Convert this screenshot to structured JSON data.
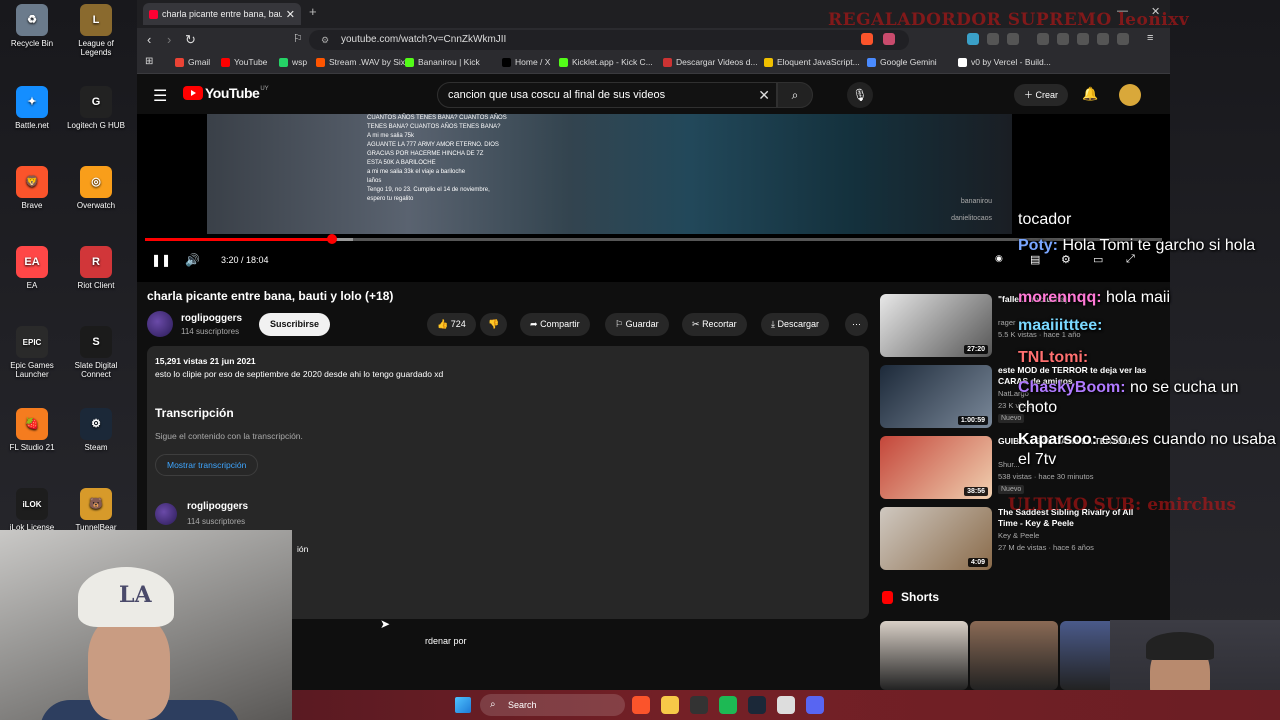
{
  "stream_overlay": {
    "title": "REGALADORDOR SUPREMO leonixv",
    "last_sub": "ULTIMO SUB: emirchus",
    "chat": [
      {
        "user": "",
        "text": "tocador",
        "color": "#ffffff"
      },
      {
        "user": "Poty:",
        "text": " Hola Tomi te garcho si hola",
        "color": "#7aa6ff"
      },
      {
        "user": "morennqq:",
        "text": " hola maii",
        "color": "#ff7ad6"
      },
      {
        "user": "maaiiitttee:",
        "text": "",
        "color": "#7ad8ff"
      },
      {
        "user": "TNLtomi:",
        "text": "",
        "color": "#ff7070"
      },
      {
        "user": "ChaskyBoom:",
        "text": " no se cucha un choto",
        "color": "#b07aff"
      },
      {
        "user": "Kaparsoo:",
        "text": " eso es cuando no usaba el 7tv",
        "color": "#ffffff"
      }
    ]
  },
  "desktop": {
    "icons": [
      {
        "label": "Recycle Bin",
        "icon": "recycle-bin-icon",
        "color": "#6b7b8c",
        "glyph": "♻"
      },
      {
        "label": "League of Legends",
        "icon": "league-icon",
        "color": "#8a6a2e",
        "glyph": "L"
      },
      {
        "label": "Battle.net",
        "icon": "battlenet-icon",
        "color": "#148eff",
        "glyph": "✦"
      },
      {
        "label": "Logitech G HUB",
        "icon": "logitech-icon",
        "color": "#222222",
        "glyph": "G"
      },
      {
        "label": "Brave",
        "icon": "brave-icon",
        "color": "#fb542b",
        "glyph": "🦁"
      },
      {
        "label": "Overwatch",
        "icon": "overwatch-icon",
        "color": "#f99e1a",
        "glyph": "◎"
      },
      {
        "label": "EA",
        "icon": "ea-icon",
        "color": "#ff4747",
        "glyph": "EA"
      },
      {
        "label": "Riot Client",
        "icon": "riot-icon",
        "color": "#d13639",
        "glyph": "R"
      },
      {
        "label": "Epic Games Launcher",
        "icon": "epic-icon",
        "color": "#2a2a2a",
        "glyph": "EPIC"
      },
      {
        "label": "Slate Digital Connect",
        "icon": "slate-icon",
        "color": "#1b1b1b",
        "glyph": "S"
      },
      {
        "label": "FL Studio 21",
        "icon": "flstudio-icon",
        "color": "#f57c1f",
        "glyph": "🍓"
      },
      {
        "label": "Steam",
        "icon": "steam-icon",
        "color": "#1b2838",
        "glyph": "⚙"
      },
      {
        "label": "iLok License",
        "icon": "ilok-icon",
        "color": "#1d1d1d",
        "glyph": "iLOK"
      },
      {
        "label": "TunnelBear",
        "icon": "tunnelbear-icon",
        "color": "#d79a2a",
        "glyph": "🐻"
      }
    ]
  },
  "browser": {
    "tab_title": "charla picante entre bana, bauti",
    "url": "youtube.com/watch?v=CnnZkWkmJII",
    "bookmarks": [
      {
        "label": "Gmail",
        "color": "#ea4335"
      },
      {
        "label": "YouTube",
        "color": "#ff0000"
      },
      {
        "label": "wsp",
        "color": "#25d366"
      },
      {
        "label": "Stream .WAV by Six...",
        "color": "#ff5500"
      },
      {
        "label": "Bananirou | Kick",
        "color": "#53fc18"
      },
      {
        "label": "Home / X",
        "color": "#000000"
      },
      {
        "label": "Kicklet.app - Kick C...",
        "color": "#53fc18"
      },
      {
        "label": "Descargar Videos d...",
        "color": "#cc3333"
      },
      {
        "label": "Eloquent JavaScript...",
        "color": "#f0c000"
      },
      {
        "label": "Google Gemini",
        "color": "#4a8bff"
      },
      {
        "label": "v0 by Vercel - Build...",
        "color": "#ffffff"
      }
    ]
  },
  "youtube": {
    "logo": "YouTube",
    "country": "UY",
    "search_query": "cancion que usa coscu al final de sus videos",
    "create_label": "Crear",
    "player": {
      "time": "3:20 / 18:04",
      "played_fraction": 0.184,
      "buffered_fraction": 0.205,
      "overlay_lines": [
        "CUANTOS AÑOS TENES BANA? CUANTOS AÑOS",
        "TENES BANA? CUANTOS AÑOS TENES BANA?",
        "A mi me salia 75k",
        "AGUANTE LA 777 ARMY AMOR ETERNO. DIOS",
        "GRACIAS POR HACERME HINCHA DE 7Z",
        "ESTA 50K A BARILOCHE",
        "a mi me salia 33k el viaje a bariloche",
        "laños",
        "Tengo 19, no 23. Cumplio el 14 de noviembre,",
        "espero tu regalito"
      ],
      "watermark1": "bananirou",
      "watermark2": "danielitocaos"
    },
    "video_title": "charla picante entre bana, bauti y lolo (+18)",
    "channel": {
      "name": "roglipoggers",
      "subs": "114 suscriptores"
    },
    "subscribe_label": "Suscribirse",
    "likes": "724",
    "share_label": "Compartir",
    "save_label": "Guardar",
    "clip_label": "Recortar",
    "download_label": "Descargar",
    "description": {
      "meta": "15,291 vistas  21 jun 2021",
      "text": "esto lo clipie por eso de septiembre de 2020 desde ahi lo tengo guardado xd",
      "transcript_heading": "Transcripción",
      "transcript_sub": "Sigue el contenido con la transcripción.",
      "transcript_button": "Mostrar transcripción",
      "partial_button": "ión"
    },
    "comments_sort": "rdenar por",
    "related": [
      {
        "title": "\"falle... nocturna)",
        "channel": "rager",
        "meta": "5.5 K vistas · hace 1 año",
        "duration": "27:20",
        "badge": "",
        "c1": "#e8e8e8",
        "c2": "#555555"
      },
      {
        "title": "este MOD de TERROR te deja ver las CARAS de amigos",
        "channel": "NatLargo",
        "meta": "23 K vistas",
        "duration": "1:00:59",
        "badge": "Nuevo",
        "c1": "#1d2a3a",
        "c2": "#7a8899"
      },
      {
        "title": "GUIBO... SALIDA de LA TERTULIA!",
        "channel": "Shur...",
        "meta": "538 vistas · hace 30 minutos",
        "duration": "38:56",
        "badge": "Nuevo",
        "c1": "#c4463a",
        "c2": "#f0d0b0"
      },
      {
        "title": "The Saddest Sibling Rivalry of All Time - Key & Peele",
        "channel": "Key & Peele",
        "meta": "27 M de vistas · hace 6 años",
        "duration": "4:09",
        "badge": "",
        "c1": "#cfc8c0",
        "c2": "#8a6b4a"
      }
    ],
    "shorts_label": "Shorts",
    "shorts": [
      {
        "color": "#d8cfc6"
      },
      {
        "color": "#8a6a55"
      },
      {
        "color": "#4a5a8a"
      }
    ]
  },
  "taskbar": {
    "search": "Search",
    "apps": [
      {
        "icon": "brave-taskbar-icon",
        "color": "#fb542b"
      },
      {
        "icon": "folder-taskbar-icon",
        "color": "#f7c948"
      },
      {
        "icon": "obs-taskbar-icon",
        "color": "#333333"
      },
      {
        "icon": "spotify-taskbar-icon",
        "color": "#1db954"
      },
      {
        "icon": "steam-taskbar-icon",
        "color": "#1b2838"
      },
      {
        "icon": "app-taskbar-icon",
        "color": "#dddddd"
      },
      {
        "icon": "discord-taskbar-icon",
        "color": "#5865f2"
      }
    ]
  }
}
